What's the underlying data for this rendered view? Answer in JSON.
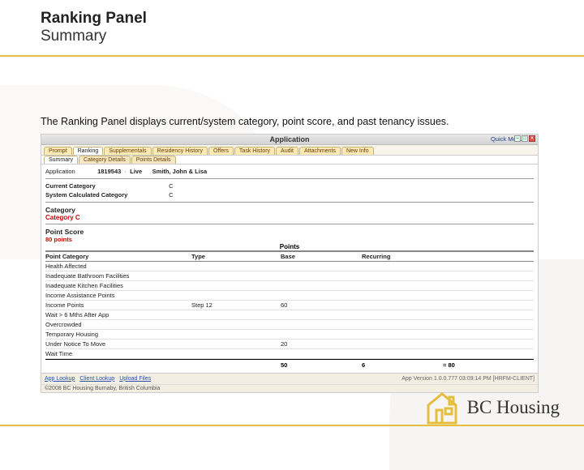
{
  "slide": {
    "title1": "Ranking Panel",
    "title2": "Summary",
    "description": "The Ranking Panel displays current/system category, point score, and past tenancy issues."
  },
  "app": {
    "window_title": "Application",
    "quick_menu": "Quick Menu",
    "tabs": [
      "Prompt",
      "Ranking",
      "Supplementals",
      "Residency History",
      "Offers",
      "Task History",
      "Audit",
      "Attachments",
      "New Info"
    ],
    "active_tab": 1,
    "subtabs": [
      "Summary",
      "Category Details",
      "Points Details"
    ],
    "active_subtab": 0,
    "application_label": "Application",
    "application_id": "1819543",
    "application_status": "Live",
    "applicant_name": "Smith, John & Lisa",
    "current_category_label": "Current Category",
    "current_category_value": "C",
    "system_category_label": "System Calculated Category",
    "system_category_value": "C",
    "category_head": "Category",
    "category_line": "Category C",
    "point_score_head": "Point Score",
    "points_subhead": "80 points",
    "grid_header_center": "Points",
    "grid_cols": [
      "Point Category",
      "Type",
      "Base",
      "Recurring",
      ""
    ],
    "grid_rows": [
      {
        "cat": "Health Affected",
        "type": "",
        "base": "",
        "recurring": ""
      },
      {
        "cat": "Inadequate Bathroom Facilities",
        "type": "",
        "base": "",
        "recurring": ""
      },
      {
        "cat": "Inadequate Kitchen Facilities",
        "type": "",
        "base": "",
        "recurring": ""
      },
      {
        "cat": "Income Assistance Points",
        "type": "",
        "base": "",
        "recurring": ""
      },
      {
        "cat": "Income Points",
        "type": "Step 12",
        "base": "60",
        "recurring": ""
      },
      {
        "cat": "Wait > 6 Mths After App",
        "type": "",
        "base": "",
        "recurring": ""
      },
      {
        "cat": "Overcrowded",
        "type": "",
        "base": "",
        "recurring": ""
      },
      {
        "cat": "Temporary Housing",
        "type": "",
        "base": "",
        "recurring": ""
      },
      {
        "cat": "Under Notice To Move",
        "type": "",
        "base": "20",
        "recurring": ""
      },
      {
        "cat": "Wait Time",
        "type": "",
        "base": "",
        "recurring": ""
      }
    ],
    "totals": {
      "base": "50",
      "recurring": "6",
      "equals": "= 80"
    },
    "footer": {
      "links": [
        "App Lookup",
        "Client Lookup",
        "Upload Files"
      ],
      "version": "App Version 1.0.0.777 03:09:14 PM [HRFM-CLIENT]",
      "copyright": "©2008 BC Housing Burnaby, British Columbia"
    }
  },
  "brand": "BC Housing"
}
